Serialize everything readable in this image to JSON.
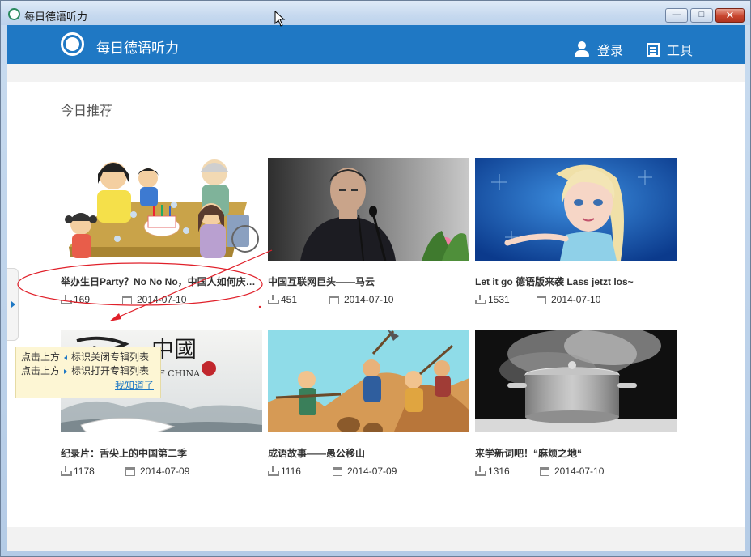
{
  "window": {
    "title": "每日德语听力",
    "min": "—",
    "max": "□",
    "close": "✕"
  },
  "header": {
    "app_name": "每日德语听力",
    "login": "登录",
    "tools": "工具"
  },
  "section": {
    "title": "今日推荐"
  },
  "cards": [
    {
      "title": "举办生日Party？No No No，中国人如何庆…",
      "downloads": "169",
      "date": "2014-07-10"
    },
    {
      "title": "中国互联网巨头——马云",
      "downloads": "451",
      "date": "2014-07-10"
    },
    {
      "title": "Let it go 德语版来袭 Lass jetzt los~",
      "downloads": "1531",
      "date": "2014-07-10"
    },
    {
      "title": "纪录片：舌尖上的中国第二季",
      "downloads": "1178",
      "date": "2014-07-09"
    },
    {
      "title": "成语故事——愚公移山",
      "downloads": "1116",
      "date": "2014-07-09"
    },
    {
      "title": "来学新词吧！“麻烦之地“",
      "downloads": "1316",
      "date": "2014-07-10"
    }
  ],
  "tooltip": {
    "line1_prefix": "点击上方",
    "line1_suffix": "标识关闭专辑列表",
    "line2_prefix": "点击上方",
    "line2_suffix": "标识打开专辑列表",
    "link": "我知道了"
  },
  "thumb_text": {
    "china_title": "中國",
    "china_sub": "OF CHINA",
    "china_a": "E"
  },
  "colors": {
    "header": "#1f78c4",
    "annotation": "#e0202a",
    "tooltip_bg": "#fdf6d4"
  }
}
